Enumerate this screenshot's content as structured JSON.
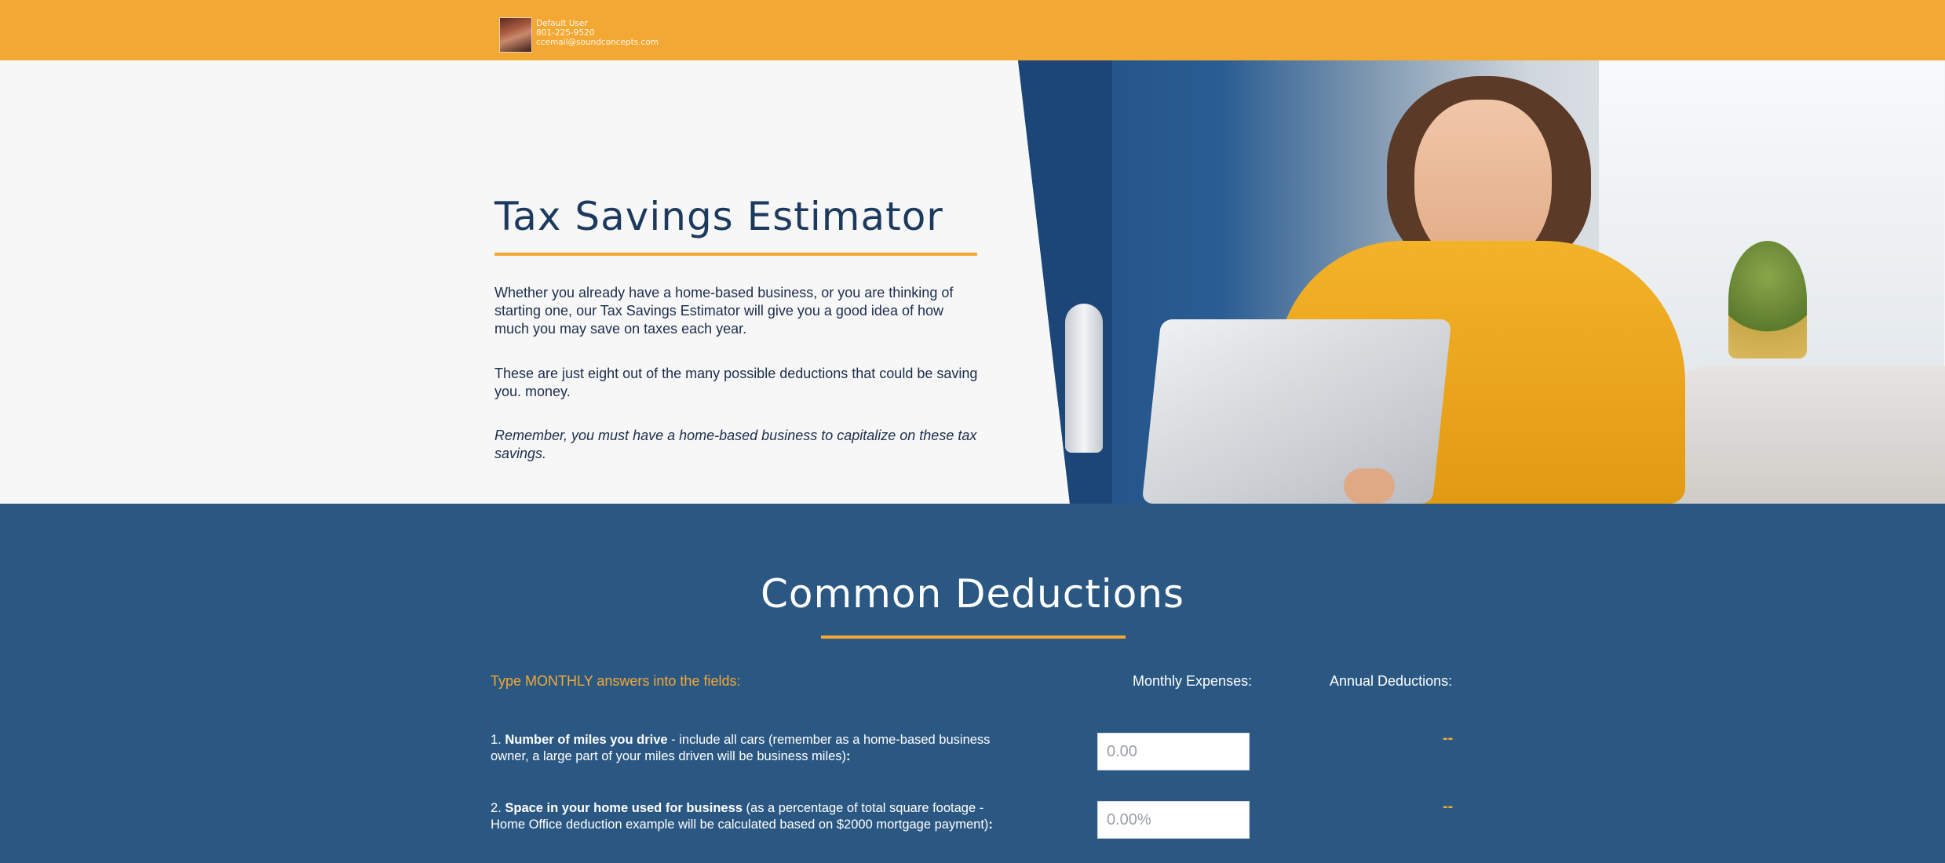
{
  "header": {
    "user_name": "Default User",
    "user_phone": "801-225-9520",
    "user_email": "ccemail@soundconcepts.com"
  },
  "hero": {
    "title": "Tax Savings Estimator",
    "paragraph1": "Whether you already have a home-based business, or you are thinking of starting one, our Tax Savings Estimator will give you a good idea of how much you may save on taxes each year.",
    "paragraph2": "These are just eight out of the many possible deductions that could be saving you. money.",
    "paragraph3": "Remember, you must have a home-based business to capitalize on these tax savings."
  },
  "deductions": {
    "title": "Common Deductions",
    "instruction": "Type MONTHLY answers into the fields:",
    "monthly_header": "Monthly Expenses:",
    "annual_header": "Annual Deductions:",
    "questions": [
      {
        "number": "1.",
        "bold": "Number of miles you drive",
        "rest": " - include all cars (remember as a home-based business owner, a large part of your miles driven will be business miles)",
        "suffix": ":",
        "placeholder": "0.00",
        "result": "--"
      },
      {
        "number": "2.",
        "bold": "Space in your home used for business",
        "rest": " (as a percentage of total square footage - Home Office deduction example will be calculated based on $2000 mortgage payment)",
        "suffix": ":",
        "placeholder": "0.00%",
        "result": "--"
      }
    ]
  },
  "colors": {
    "accent_orange": "#f4a834",
    "navy": "#2b5883",
    "title_text": "#1c3a5e"
  }
}
